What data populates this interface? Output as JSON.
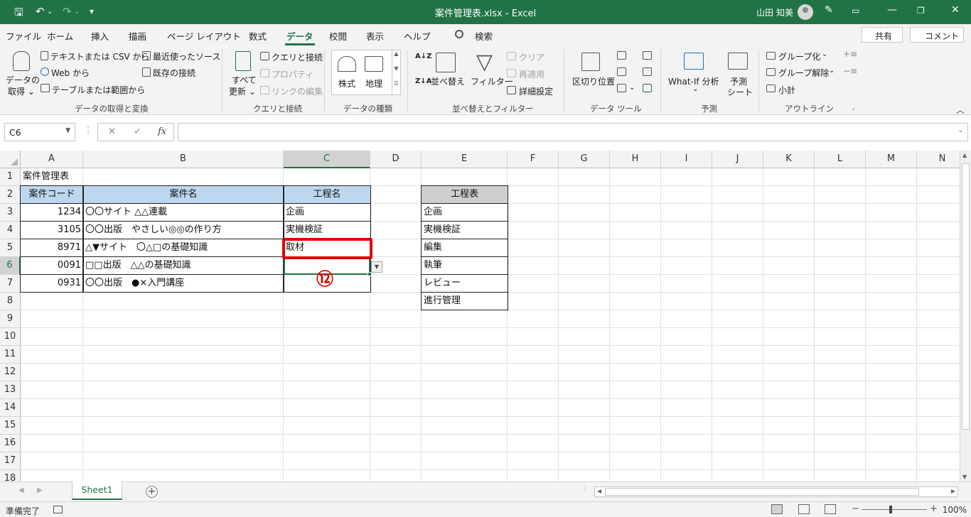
{
  "window": {
    "title": "案件管理表.xlsx  -  Excel",
    "user": "山田 知美"
  },
  "tabs": [
    "ファイル",
    "ホーム",
    "挿入",
    "描画",
    "ページ レイアウト",
    "数式",
    "データ",
    "校閲",
    "表示",
    "ヘルプ"
  ],
  "active_tab": "データ",
  "search_label": "検索",
  "share_label": "共有",
  "comment_label": "コメント",
  "ribbon": {
    "get_data": {
      "get_data_label_1": "データの",
      "get_data_label_2": "取得 ⌄",
      "text_csv": "テキストまたは CSV から",
      "web": "Web から",
      "table_range": "テーブルまたは範囲から",
      "recent_sources": "最近使ったソース",
      "existing_connections": "既存の接続",
      "group_label": "データの取得と変換"
    },
    "queries": {
      "refresh_all_1": "すべて",
      "refresh_all_2": "更新 ⌄",
      "queries_connections": "クエリと接続",
      "properties": "プロパティ",
      "edit_links": "リンクの編集",
      "group_label": "クエリと接続"
    },
    "data_types": {
      "stocks": "株式",
      "geography": "地理",
      "group_label": "データの種類"
    },
    "sort_filter": {
      "sort": "並べ替え",
      "filter": "フィルター",
      "clear": "クリア",
      "reapply": "再適用",
      "advanced": "詳細設定",
      "group_label": "並べ替えとフィルター"
    },
    "data_tools": {
      "text_to_columns": "区切り位置",
      "group_label": "データ ツール"
    },
    "forecast": {
      "what_if": "What-If 分析",
      "what_if_arrow": "⌄",
      "forecast_sheet_1": "予測",
      "forecast_sheet_2": "シート",
      "group_label": "予測"
    },
    "outline": {
      "group": "グループ化",
      "ungroup": "グループ解除",
      "subtotal": "小計",
      "group_label": "アウトライン"
    }
  },
  "formula_bar": {
    "name_box": "C6",
    "fx_label": "fx",
    "formula": ""
  },
  "columns": [
    "A",
    "B",
    "C",
    "D",
    "E",
    "F",
    "G",
    "H",
    "I",
    "J",
    "K",
    "L",
    "M",
    "N"
  ],
  "rows": [
    "1",
    "2",
    "3",
    "4",
    "5",
    "6",
    "7",
    "8",
    "9",
    "10",
    "11",
    "12",
    "13",
    "14",
    "15",
    "16",
    "17",
    "18"
  ],
  "sheet": {
    "title": "案件管理表",
    "headers": {
      "code": "案件コード",
      "name": "案件名",
      "process": "工程名"
    },
    "records": [
      {
        "code": "1234",
        "name": "〇〇サイト △△連載",
        "process": "企画"
      },
      {
        "code": "3105",
        "name": "〇〇出版　やさしい◎◎の作り方",
        "process": "実機検証"
      },
      {
        "code": "8971",
        "name": "△▼サイト　〇△□の基礎知識",
        "process": "取材"
      },
      {
        "code": "0091",
        "name": "□□出版　△△の基礎知識",
        "process": ""
      },
      {
        "code": "0931",
        "name": "〇〇出版　●×入門講座",
        "process": ""
      }
    ],
    "process_table": {
      "header": "工程表",
      "items": [
        "企画",
        "実機検証",
        "編集",
        "執筆",
        "レビュー",
        "進行管理"
      ]
    }
  },
  "annotation": {
    "step": "⑫",
    "color": "#e00000"
  },
  "sheet_tab": "Sheet1",
  "status": {
    "text": "準備完了",
    "zoom": "100%"
  },
  "colors": {
    "brand": "#217346",
    "header_fill_blue": "#bdd7ee",
    "header_fill_gray": "#d0cece"
  }
}
